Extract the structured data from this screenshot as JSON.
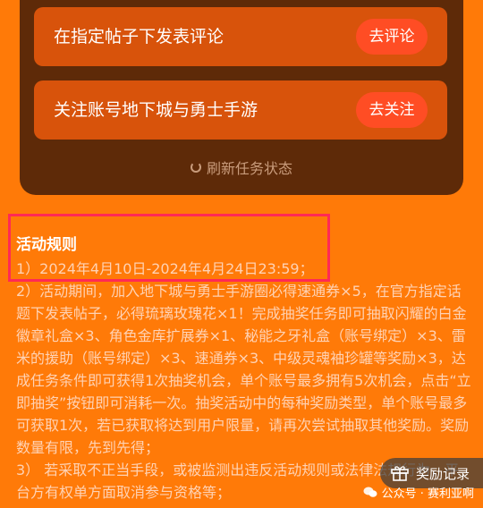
{
  "tasks": [
    {
      "label": "在指定帖子下发表评论",
      "button": "去评论"
    },
    {
      "label": "关注账号地下城与勇士手游",
      "button": "去关注"
    }
  ],
  "refresh_label": "刷新任务状态",
  "rules": {
    "title": "活动规则",
    "lines": [
      "1）2024年4月10日-2024年4月24日23:59；",
      "2）活动期间，加入地下城与勇士手游圈必得速通券×5，在官方指定话题下发表帖子，必得琉璃玫瑰花×1！完成抽奖任务即可抽取闪耀的白金徽章礼盒×3、角色金库扩展券×1、秘能之牙礼盒（账号绑定）×3、雷米的援助（账号绑定）×3、速通券×3、中级灵魂袖珍罐等奖励×3，达成任务条件即可获得1次抽奖机会，单个账号最多拥有5次机会，点击“立即抽奖”按钮即可消耗一次。抽奖活动中的每种奖励类型，单个账号最多可获取1次，若已获取将达到用户限量，请再次尝试抽取其他奖励。奖励数量有限，先到先得；",
      "3） 若采取不正当手段，或被监测出违反活动规则或法律法规行为，平台方有权单方面取消参与资格等；"
    ]
  },
  "reward_record": {
    "label": "奖励记录",
    "icon": "gift-icon"
  },
  "watermark": {
    "text": "公众号 · 赛利亚啊",
    "icon": "wechat-icon"
  },
  "colors": {
    "background": "#ff7a08",
    "panel": "#5e2a08",
    "card": "#d8530b",
    "button": "#ff4d24",
    "highlight": "#ff2a55"
  }
}
